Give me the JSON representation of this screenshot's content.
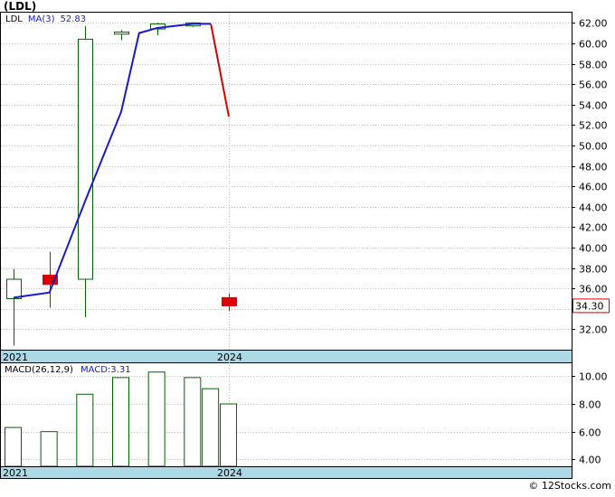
{
  "header": {
    "ticker": "(LDL)"
  },
  "footer": {
    "brand": "© 12Stocks.com"
  },
  "price_panel": {
    "legend": {
      "symbol": "LDL",
      "ma_label": "MA(3)",
      "ma_value": "52.83"
    },
    "last_price_label": "34.30",
    "x_axis_labels": [
      "2021",
      "2024"
    ]
  },
  "macd_panel": {
    "legend": {
      "macd_params": "MACD(26,12,9)",
      "macd_label": "MACD:3.31"
    },
    "x_axis_labels": [
      "2021",
      "2024"
    ]
  },
  "colors": {
    "up": "#006400",
    "down": "#dd0000",
    "ma_line": "#1a1acc",
    "ma_tail": "#dd0000",
    "axis_band": "#add8e6",
    "grid": "#bbbbbb",
    "frame": "#000000"
  },
  "chart_data": [
    {
      "type": "candlestick",
      "title": "(LDL)",
      "x": [
        2021,
        2021.5,
        2022,
        2022.5,
        2023,
        2023.5,
        2024
      ],
      "ylim": [
        30.0,
        63.0
      ],
      "yticks": [
        "32.00",
        "34.00",
        "36.00",
        "38.00",
        "40.00",
        "42.00",
        "44.00",
        "46.00",
        "48.00",
        "50.00",
        "52.00",
        "54.00",
        "56.00",
        "58.00",
        "60.00",
        "62.00"
      ],
      "candles": [
        {
          "x": 2021,
          "open": 35.0,
          "high": 37.9,
          "low": 30.4,
          "close": 36.9,
          "dir": "up"
        },
        {
          "x": 2021.5,
          "open": 37.3,
          "high": 39.6,
          "low": 34.1,
          "close": 36.4,
          "dir": "down"
        },
        {
          "x": 2022,
          "open": 36.9,
          "high": 61.7,
          "low": 33.2,
          "close": 60.4,
          "dir": "up"
        },
        {
          "x": 2022.5,
          "open": 60.9,
          "high": 61.3,
          "low": 60.3,
          "close": 61.1,
          "dir": "up"
        },
        {
          "x": 2023,
          "open": 61.4,
          "high": 62.0,
          "low": 60.8,
          "close": 61.9,
          "dir": "up"
        },
        {
          "x": 2023.5,
          "open": 61.7,
          "high": 62.0,
          "low": 61.6,
          "close": 62.0,
          "dir": "up"
        },
        {
          "x": 2024,
          "open": 35.1,
          "high": 35.5,
          "low": 33.8,
          "close": 34.3,
          "dir": "down"
        }
      ],
      "series": [
        {
          "name": "MA(3)",
          "points": [
            [
              2021,
              35.1
            ],
            [
              2021.5,
              35.6
            ],
            [
              2022,
              44.6
            ],
            [
              2022.5,
              53.3
            ],
            [
              2022.75,
              61.0
            ],
            [
              2023,
              61.5
            ],
            [
              2023.5,
              61.9
            ],
            [
              2023.75,
              61.9
            ],
            [
              2024,
              52.83
            ]
          ]
        }
      ],
      "last_price": 34.3
    },
    {
      "type": "bar",
      "title": "MACD(26,12,9)",
      "x": [
        2021,
        2021.5,
        2022,
        2022.5,
        2023,
        2023.5,
        2023.75,
        2024
      ],
      "values": [
        6.3,
        6.0,
        8.7,
        9.9,
        10.3,
        9.9,
        9.1,
        8.0
      ],
      "ylim": [
        3.5,
        11.0
      ],
      "yticks": [
        "4.00",
        "6.00",
        "8.00",
        "10.00"
      ],
      "last_value": 3.31
    }
  ]
}
